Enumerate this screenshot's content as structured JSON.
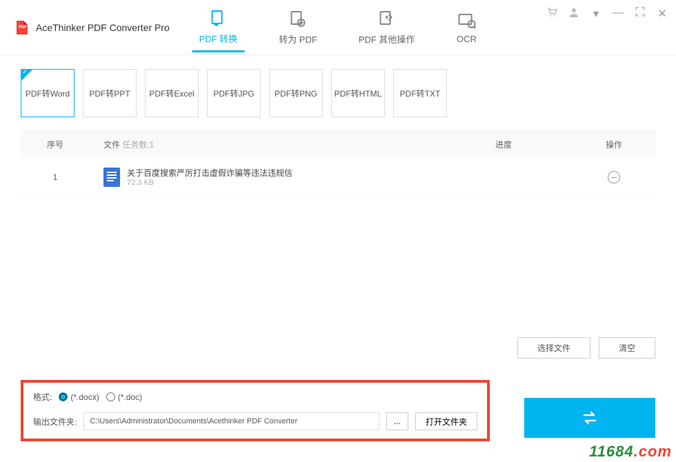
{
  "app": {
    "title": "AceThinker PDF Converter Pro"
  },
  "nav": {
    "tabs": [
      {
        "label": "PDF 转换",
        "active": true
      },
      {
        "label": "转为 PDF",
        "active": false
      },
      {
        "label": "PDF 其他操作",
        "active": false
      },
      {
        "label": "OCR",
        "active": false
      }
    ]
  },
  "formats": [
    {
      "label": "PDF转Word",
      "selected": true
    },
    {
      "label": "PDF转PPT",
      "selected": false
    },
    {
      "label": "PDF转Excel",
      "selected": false
    },
    {
      "label": "PDF转JPG",
      "selected": false
    },
    {
      "label": "PDF转PNG",
      "selected": false
    },
    {
      "label": "PDF转HTML",
      "selected": false
    },
    {
      "label": "PDF转TXT",
      "selected": false
    }
  ],
  "table": {
    "headers": {
      "index": "序号",
      "file": "文件",
      "task_count": "任务数:1",
      "progress": "进度",
      "op": "操作"
    },
    "rows": [
      {
        "index": "1",
        "name": "关于百度搜索严厉打击虚假诈骗等违法违规信",
        "size": "72.3 KB"
      }
    ]
  },
  "actions": {
    "select_file": "选择文件",
    "clear": "清空"
  },
  "output": {
    "format_label": "格式:",
    "docx": "(*.docx)",
    "doc": "(*.doc)",
    "folder_label": "输出文件夹:",
    "folder_path": "C:\\Users\\Administrator\\Documents\\Acethinker PDF Converter",
    "browse": "...",
    "open_folder": "打开文件夹"
  },
  "watermark": {
    "text": "11684",
    "suffix": ".com"
  }
}
